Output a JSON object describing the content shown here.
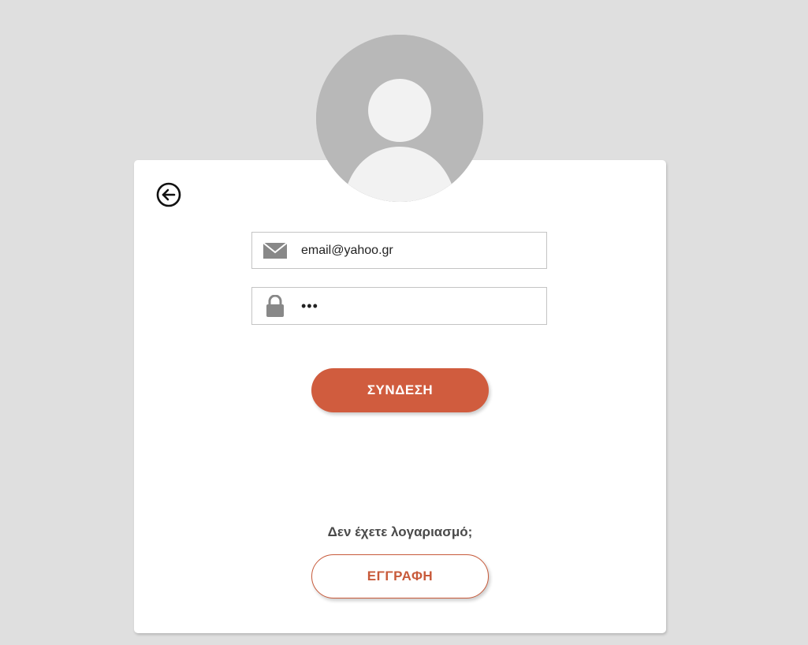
{
  "login_form": {
    "email_value": "email@yahoo.gr",
    "password_value": "•••",
    "login_label": "ΣΥΝΔΕΣΗ"
  },
  "signup": {
    "prompt": "Δεν έχετε λογαριασμό;",
    "register_label": "ΕΓΓΡΑΦΗ"
  },
  "icons": {
    "back": "arrow-left-circle-icon",
    "email": "envelope-icon",
    "password": "lock-icon",
    "avatar": "user-silhouette-icon"
  },
  "colors": {
    "background": "#dfdfdf",
    "card": "#ffffff",
    "accent": "#d05c3e",
    "avatar_bg": "#b8b8b8",
    "avatar_fg": "#f2f2f2",
    "icon_gray": "#888888"
  }
}
